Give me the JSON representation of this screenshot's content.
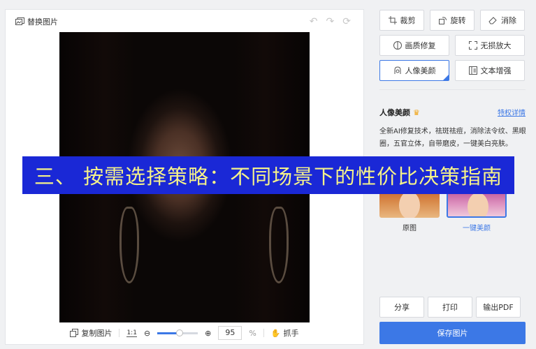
{
  "toolbar": {
    "replace_label": "替换图片",
    "undo_icon": "undo-icon",
    "redo_icon": "redo-icon",
    "reset_icon": "reset-icon"
  },
  "tools": {
    "crop": "裁剪",
    "rotate": "旋转",
    "erase": "消除",
    "repair": "画质修复",
    "upscale": "无损放大",
    "portrait": "人像美颜",
    "text_enhance": "文本增强"
  },
  "portrait_panel": {
    "title": "人像美颜",
    "detail_link": "特权详情",
    "description": "全新AI修复技术，祛斑祛痘，消除法令纹、黑眼圈，五官立体，自带磨皮，一键美白亮肤。",
    "thumbs": [
      {
        "label": "原图"
      },
      {
        "label": "一键美颜"
      }
    ]
  },
  "bottom_bar": {
    "copy_label": "复制图片",
    "ratio_label": "1:1",
    "zoom_value": "95",
    "zoom_unit": "%",
    "zoom_fraction": 0.55,
    "hand_label": "抓手"
  },
  "actions": {
    "share": "分享",
    "print": "打印",
    "export_pdf": "输出PDF",
    "save": "保存图片"
  },
  "banner": {
    "text": "三、 按需选择策略：不同场景下的性价比决策指南"
  },
  "colors": {
    "accent": "#3c78e6",
    "banner_bg": "#1a28d6",
    "banner_text": "#f5f28a",
    "crown": "#f1a20f"
  }
}
